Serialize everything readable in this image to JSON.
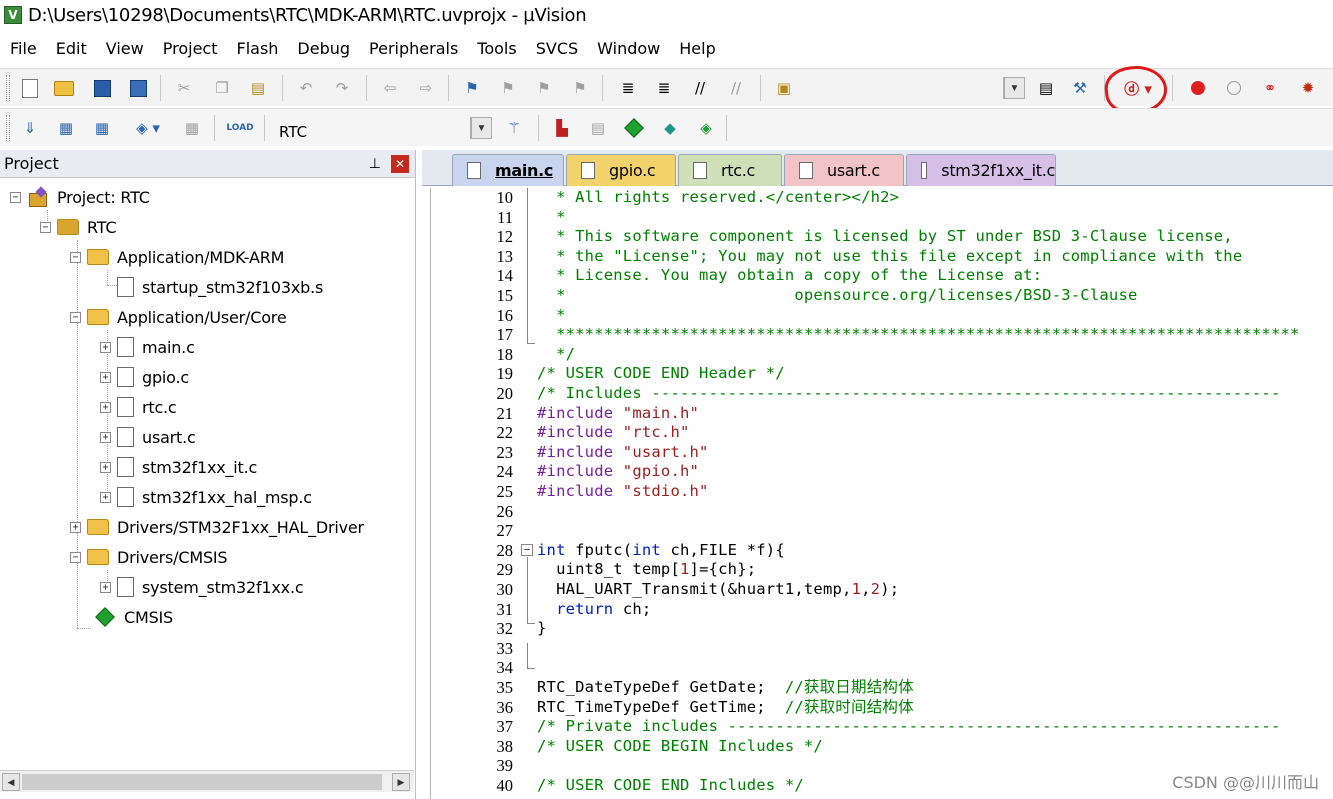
{
  "window": {
    "title": "D:\\Users\\10298\\Documents\\RTC\\MDK-ARM\\RTC.uvprojx - µVision",
    "icon": "uvision-app-icon"
  },
  "menu": [
    "File",
    "Edit",
    "View",
    "Project",
    "Flash",
    "Debug",
    "Peripherals",
    "Tools",
    "SVCS",
    "Window",
    "Help"
  ],
  "toolbar2": {
    "target_name": "RTC"
  },
  "project_panel": {
    "title": "Project",
    "tree": [
      {
        "label": "Project: RTC"
      },
      {
        "label": "RTC"
      },
      {
        "label": "Application/MDK-ARM"
      },
      {
        "label": "startup_stm32f103xb.s"
      },
      {
        "label": "Application/User/Core"
      },
      {
        "label": "main.c"
      },
      {
        "label": "gpio.c"
      },
      {
        "label": "rtc.c"
      },
      {
        "label": "usart.c"
      },
      {
        "label": "stm32f1xx_it.c"
      },
      {
        "label": "stm32f1xx_hal_msp.c"
      },
      {
        "label": "Drivers/STM32F1xx_HAL_Driver"
      },
      {
        "label": "Drivers/CMSIS"
      },
      {
        "label": "system_stm32f1xx.c"
      },
      {
        "label": "CMSIS"
      }
    ]
  },
  "editor": {
    "tabs": [
      {
        "label": "main.c",
        "color": "#c9d5ee",
        "active": true
      },
      {
        "label": "gpio.c",
        "color": "#f2d36b"
      },
      {
        "label": "rtc.c",
        "color": "#cfe0b8"
      },
      {
        "label": "usart.c",
        "color": "#f2c4c8"
      },
      {
        "label": "stm32f1xx_it.c",
        "color": "#d6bfe6"
      }
    ],
    "lines": [
      {
        "n": "10",
        "text": "  * All rights reserved.</center></h2>"
      },
      {
        "n": "11",
        "text": "  *"
      },
      {
        "n": "12",
        "text": "  * This software component is licensed by ST under BSD 3-Clause license,"
      },
      {
        "n": "13",
        "text": "  * the \"License\"; You may not use this file except in compliance with the"
      },
      {
        "n": "14",
        "text": "  * License. You may obtain a copy of the License at:"
      },
      {
        "n": "15",
        "text": "  *                        opensource.org/licenses/BSD-3-Clause"
      },
      {
        "n": "16",
        "text": "  *"
      },
      {
        "n": "17",
        "text": "  ******************************************************************************"
      },
      {
        "n": "18",
        "text": "  */"
      },
      {
        "n": "19",
        "text": "/* USER CODE END Header */"
      },
      {
        "n": "20",
        "text": "/* Includes ------------------------------------------------------------------"
      },
      {
        "n": "21",
        "text": "#include \"main.h\""
      },
      {
        "n": "22",
        "text": "#include \"rtc.h\""
      },
      {
        "n": "23",
        "text": "#include \"usart.h\""
      },
      {
        "n": "24",
        "text": "#include \"gpio.h\""
      },
      {
        "n": "25",
        "text": "#include \"stdio.h\""
      },
      {
        "n": "26",
        "text": ""
      },
      {
        "n": "27",
        "text": ""
      },
      {
        "n": "28",
        "text": "int fputc(int ch,FILE *f){"
      },
      {
        "n": "29",
        "text": "  uint8_t temp[1]={ch};"
      },
      {
        "n": "30",
        "text": "  HAL_UART_Transmit(&huart1,temp,1,2);"
      },
      {
        "n": "31",
        "text": "  return ch;"
      },
      {
        "n": "32",
        "text": "}"
      },
      {
        "n": "33",
        "text": ""
      },
      {
        "n": "34",
        "text": ""
      },
      {
        "n": "35",
        "text": "RTC_DateTypeDef GetDate;  //获取日期结构体"
      },
      {
        "n": "36",
        "text": "RTC_TimeTypeDef GetTime;  //获取时间结构体"
      },
      {
        "n": "37",
        "text": "/* Private includes ----------------------------------------------------------"
      },
      {
        "n": "38",
        "text": "/* USER CODE BEGIN Includes */"
      },
      {
        "n": "39",
        "text": ""
      },
      {
        "n": "40",
        "text": "/* USER CODE END Includes */"
      }
    ]
  },
  "watermark": "CSDN @@川川而山",
  "colors": {
    "comment": "#008000",
    "preprocessor": "#7b1fa2",
    "string": "#9c1f1f",
    "keyword": "#0020c0",
    "annotation": "#e01818"
  }
}
